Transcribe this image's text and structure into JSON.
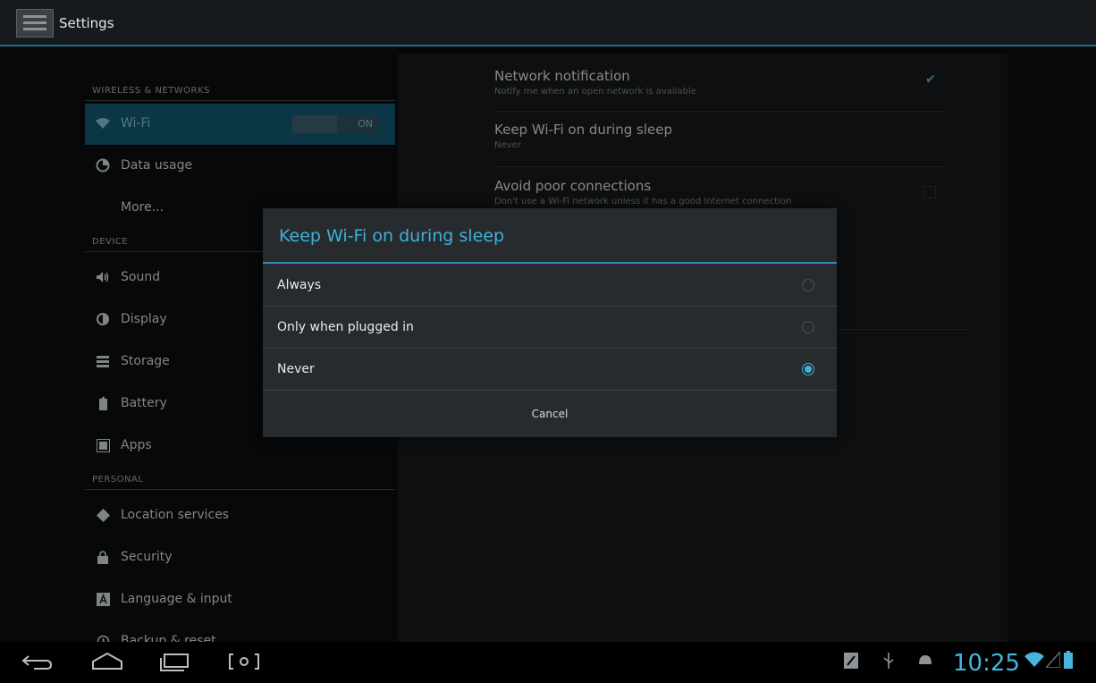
{
  "app": {
    "title": "Settings",
    "icon": "settings-app-icon"
  },
  "sidebar": {
    "sections": {
      "wireless": "WIRELESS & NETWORKS",
      "device": "DEVICE",
      "personal": "PERSONAL"
    },
    "items": [
      {
        "label": "Wi-Fi",
        "icon": "wifi-icon",
        "selected": true,
        "toggle": "ON"
      },
      {
        "label": "Data usage",
        "icon": "data-usage-icon"
      },
      {
        "label": "More..."
      },
      {
        "label": "Sound",
        "icon": "speaker-icon"
      },
      {
        "label": "Display",
        "icon": "display-icon"
      },
      {
        "label": "Storage",
        "icon": "storage-icon"
      },
      {
        "label": "Battery",
        "icon": "battery-icon"
      },
      {
        "label": "Apps",
        "icon": "apps-icon"
      },
      {
        "label": "Location services",
        "icon": "location-icon"
      },
      {
        "label": "Security",
        "icon": "lock-icon"
      },
      {
        "label": "Language & input",
        "icon": "keyboard-icon"
      },
      {
        "label": "Backup & reset",
        "icon": "backup-icon"
      }
    ]
  },
  "prefs": [
    {
      "title": "Network notification",
      "summary": "Notify me when an open network is available",
      "checked": true
    },
    {
      "title": "Keep Wi-Fi on during sleep",
      "summary": "Never"
    },
    {
      "title": "Avoid poor connections",
      "summary": "Don't use a Wi-Fi network unless it has a good Internet connection",
      "checked": false
    }
  ],
  "dialog": {
    "title": "Keep Wi-Fi on during sleep",
    "options": [
      {
        "label": "Always",
        "selected": false
      },
      {
        "label": "Only when plugged in",
        "selected": false
      },
      {
        "label": "Never",
        "selected": true
      }
    ],
    "cancel": "Cancel"
  },
  "statusbar": {
    "time": "10:25",
    "icons": [
      "screenshot-icon",
      "usb-icon",
      "android-debug-icon",
      "wifi-signal-icon",
      "cell-signal-icon",
      "battery-icon"
    ],
    "nav": [
      "back-icon",
      "home-icon",
      "recent-apps-icon",
      "screenshot-nav-icon"
    ]
  },
  "colors": {
    "accent": "#3cb2dc",
    "selected_item": "#11536a",
    "background": "#0b0d0e"
  }
}
